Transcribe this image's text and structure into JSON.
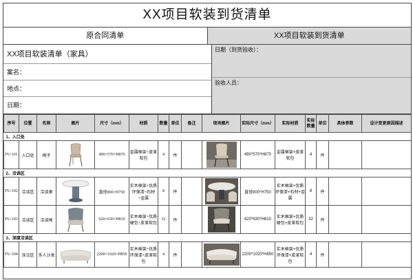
{
  "title": "XX项目软装到货清单",
  "left_header": "原合同清单",
  "right_header": "XX项目软装到货清单",
  "info": {
    "subtitle": "XX项目软装清单（家具）",
    "case_name_label": "案名：",
    "location_label": "地点：",
    "date_label": "日期：",
    "arrival_date_label": "日期（到货验收）：",
    "receiver_label": "验收人员："
  },
  "columns": {
    "seq": "序号",
    "position": "位置",
    "name": "名称",
    "image": "图片",
    "size": "尺寸（mm）",
    "material": "材质",
    "qty": "数量",
    "unit": "单位",
    "remark": "备注",
    "site_photo": "现场图片",
    "actual_size": "实际尺寸（mm）",
    "actual_material": "实际材质",
    "actual_qty": "实际数量",
    "actual_unit": "单位",
    "detail_params": "具体参数",
    "design_change": "设计变更原因描述"
  },
  "sections": [
    {
      "title": "1、入口处",
      "items": [
        {
          "seq": "FU-101",
          "position": "入口处",
          "name": "椅子",
          "image": "dining-chair-icon",
          "size": "490×570×H870",
          "material": "金属框架+皮革软包",
          "qty": "4",
          "unit": "件",
          "site_photo": "chair-photo-icon",
          "actual_size": "490*570*H870",
          "actual_material": "金属框架+皮革软包",
          "actual_qty": "4",
          "actual_unit": "件"
        }
      ]
    },
    {
      "title": "2、洽谈区",
      "items": [
        {
          "seq": "FU-102",
          "position": "洽谈区",
          "name": "洽谈桌",
          "image": "round-table-icon",
          "size": "直径800×H750",
          "material": "实木框架+优质环保漆+石材+金属",
          "qty": "8",
          "unit": "件",
          "site_photo": "table-photo-icon",
          "actual_size": "直径800*H750",
          "actual_material": "实木框架+优质环保漆+石材+金属",
          "actual_qty": "8",
          "actual_unit": "件"
        },
        {
          "seq": "FU-103",
          "position": "洽谈区",
          "name": "洽谈椅",
          "image": "armchair-icon",
          "size": "620×630×H810",
          "material": "实木框架+优质硬包+皮革软包",
          "qty": "32",
          "unit": "件",
          "site_photo": "armchair-photo-icon",
          "actual_size": "620*630*H810",
          "actual_material": "实木框架+优质硬包+皮革软包",
          "actual_qty": "32",
          "actual_unit": "件"
        }
      ]
    },
    {
      "title": "3、深度洽谈区",
      "items": [
        {
          "seq": "FU-104",
          "position": "深洽区",
          "name": "多人沙发",
          "image": "sofa-icon",
          "size": "2200×1020×H850",
          "material": "实木框架+优质环保漆+皮革软包",
          "qty": "4",
          "unit": "件",
          "site_photo": "sofa-photo-icon",
          "actual_size": "2200*1020*H850",
          "actual_material": "实木框架+优质环保漆+皮革软包",
          "actual_qty": "4",
          "actual_unit": "件"
        }
      ]
    }
  ]
}
